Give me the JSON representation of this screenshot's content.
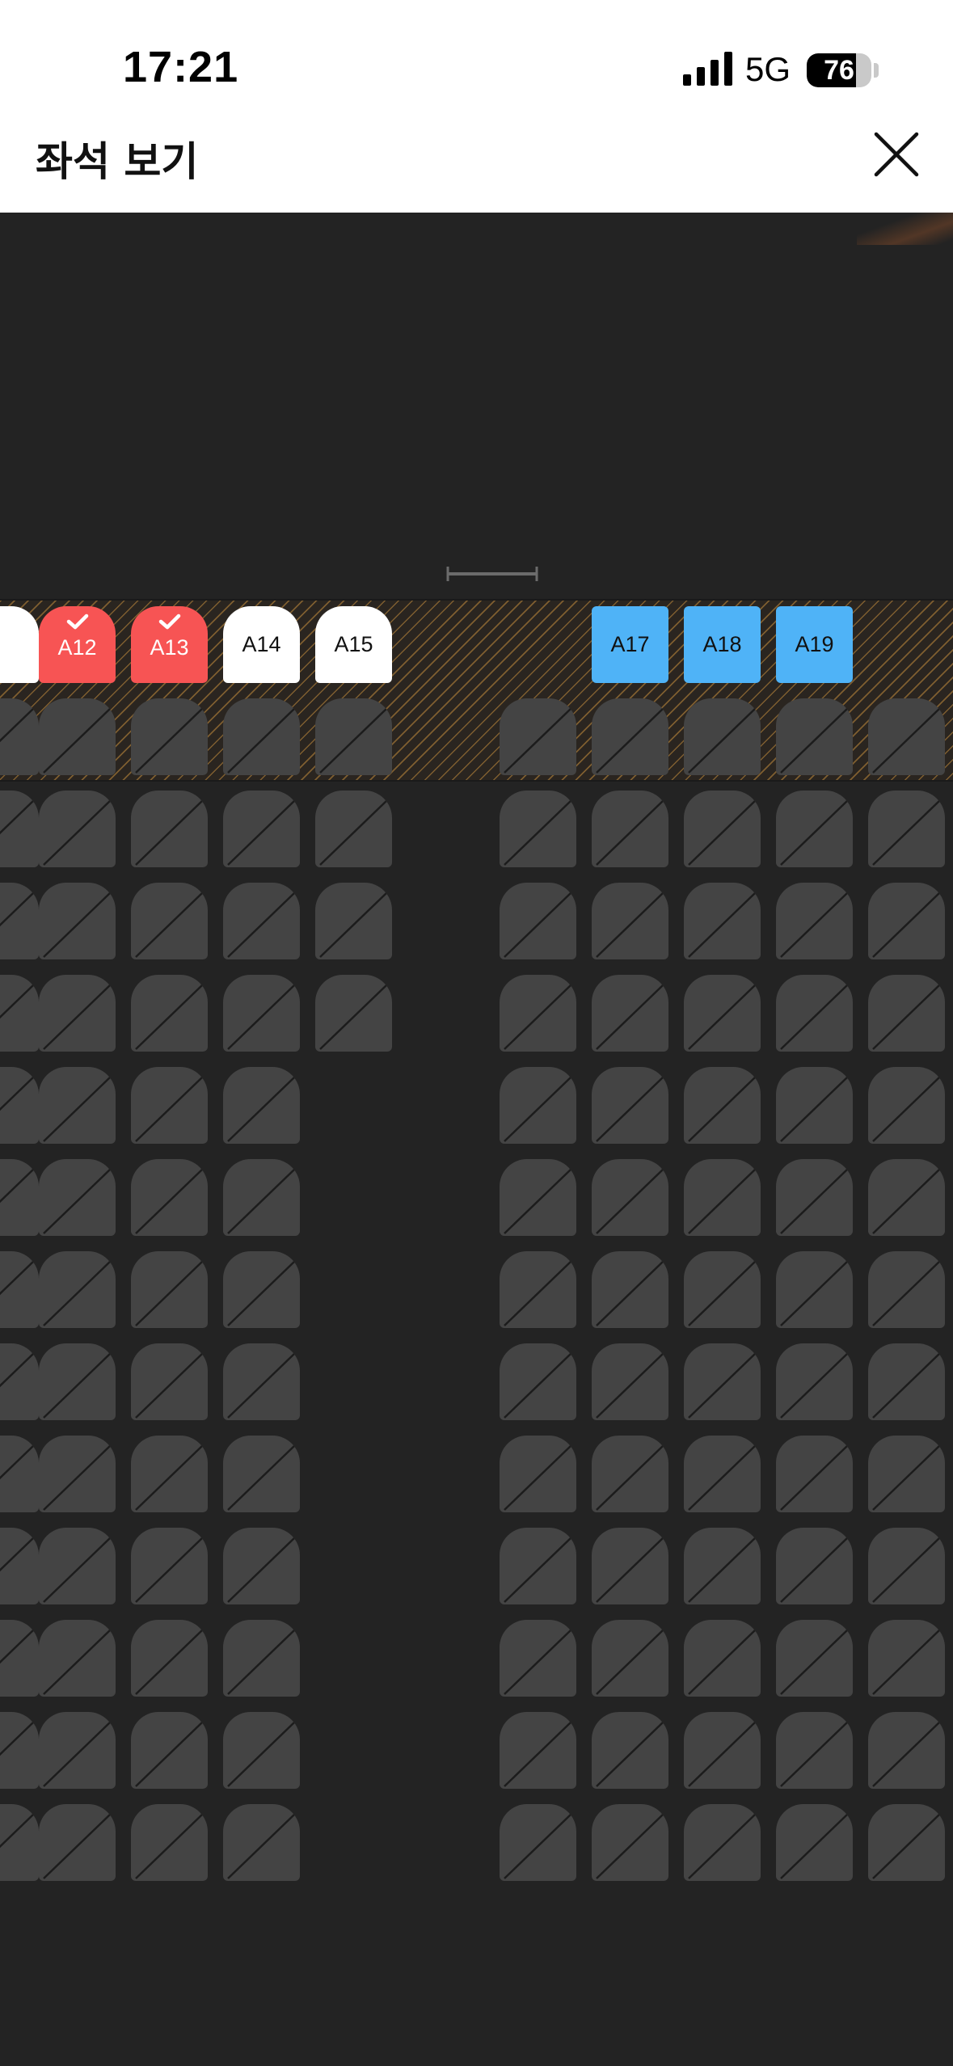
{
  "status_bar": {
    "time": "17:21",
    "network": "5G",
    "battery": "76",
    "battery_level": 0.76
  },
  "header": {
    "title": "좌석 보기",
    "close_icon": "close-icon"
  },
  "colors": {
    "background": "#232323",
    "sold_seat": "#444444",
    "available_seat": "#ffffff",
    "selected_seat": "#f75454",
    "blue_seat": "#4fb3f7",
    "premium_zone_stripe": "#c48c3c"
  },
  "seats": {
    "labeled": [
      {
        "label": "A12",
        "state": "selected"
      },
      {
        "label": "A13",
        "state": "selected"
      },
      {
        "label": "A14",
        "state": "available"
      },
      {
        "label": "A15",
        "state": "available"
      },
      {
        "label": "A17",
        "state": "blue"
      },
      {
        "label": "A18",
        "state": "blue"
      },
      {
        "label": "A19",
        "state": "blue"
      }
    ],
    "sold_icon": "sold-slash-icon"
  }
}
